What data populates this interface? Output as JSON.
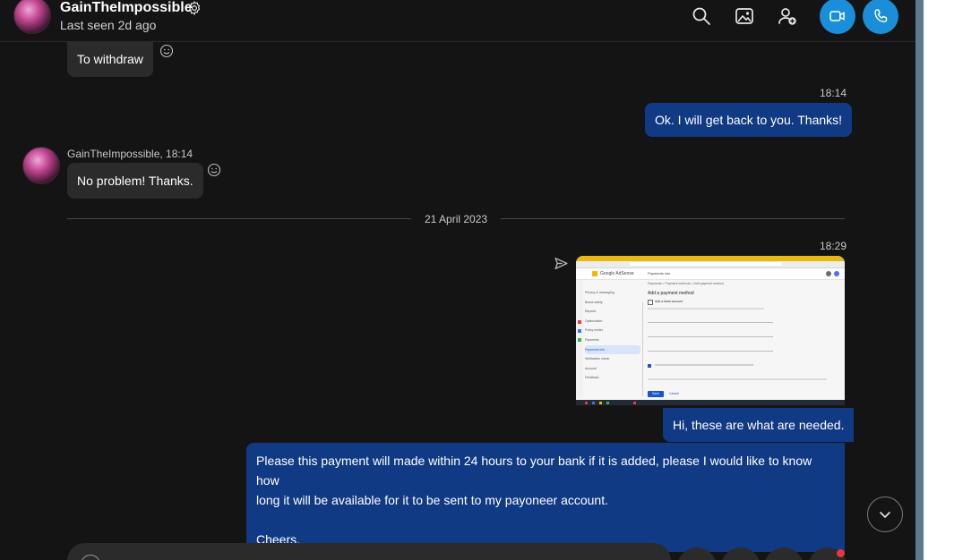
{
  "header": {
    "contact_name": "GainTheImpossible",
    "last_seen": "Last seen 2d ago"
  },
  "icons": {
    "settings": "gear-icon",
    "search": "search-icon",
    "gallery": "image-icon",
    "add_person": "add-person-icon",
    "video_call": "video-camera-icon",
    "audio_call": "phone-icon",
    "reaction": "smiley-icon",
    "sent_status": "send-icon",
    "scroll_down": "chevron-down-icon"
  },
  "colors": {
    "background": "#141414",
    "incoming_bubble": "#2b2b2b",
    "outgoing_bubble": "#113a84",
    "call_button": "#1a8ed8",
    "notification_dot": "#e8383d"
  },
  "messages": [
    {
      "direction": "in",
      "text": "To withdraw"
    },
    {
      "direction": "out",
      "time": "18:14",
      "text": "Ok. I will get back to you. Thanks!"
    },
    {
      "direction": "in",
      "sender": "GainTheImpossible, 18:14",
      "text": "No problem! Thanks."
    },
    {
      "divider": "21 April 2023"
    },
    {
      "direction": "out",
      "time": "18:29",
      "type": "image",
      "caption": "Hi, these are what are needed."
    },
    {
      "direction": "out",
      "lines": [
        "Please this payment will made within 24 hours to your bank if it is added, please I would like to know how",
        "long it will be available for it to be sent to my payoneer account.",
        "",
        "Cheers."
      ]
    }
  ],
  "screenshot": {
    "brand": "Google AdSense",
    "page": "Payments info",
    "breadcrumb": "Payments  >  Payment methods  >  Add payment method",
    "heading": "Add a payment method",
    "option": "Add a bank account",
    "nav": [
      "Privacy & messaging",
      "Brand safety",
      "Reports",
      "Optimization",
      "Policy center",
      "Payments",
      "Payments info",
      "Verification check",
      "Account",
      "Feedback"
    ],
    "buttons": [
      "Save",
      "Cancel"
    ]
  }
}
